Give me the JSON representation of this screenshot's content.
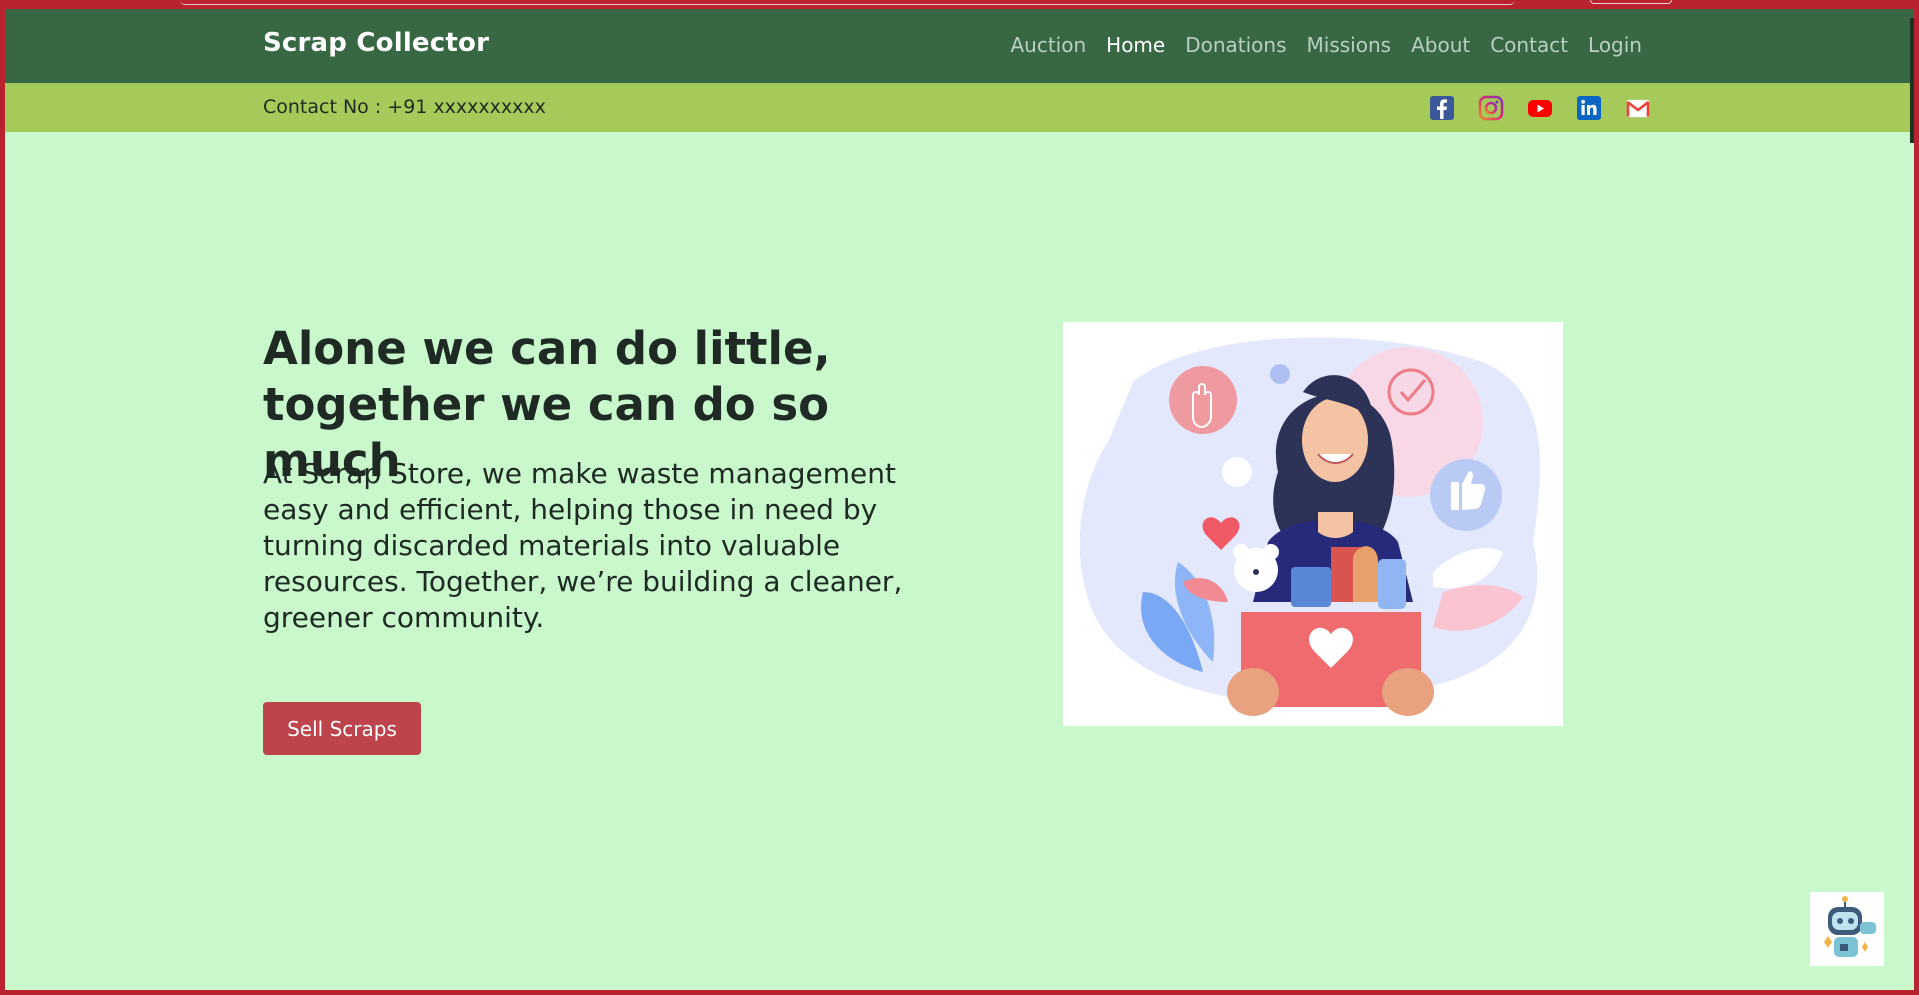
{
  "brand": "Scrap Collector",
  "nav": [
    "Auction",
    "Home",
    "Donations",
    "Missions",
    "About",
    "Contact",
    "Login"
  ],
  "nav_active": "Home",
  "contact": "Contact No : +91 xxxxxxxxxx",
  "socials": [
    "facebook-icon",
    "instagram-icon",
    "youtube-icon",
    "linkedin-icon",
    "gmail-icon"
  ],
  "hero": {
    "headline": "Alone we can do little, together we can do so much",
    "body": "At Scrap Store, we make waste management easy and efficient, helping those in need by turning discarded materials into valuable resources. Together, we’re building a cleaner, greener community.",
    "button": "Sell Scraps"
  },
  "colors": {
    "navbar": "#376843",
    "contactbar": "#a6ca5a",
    "page_bg": "#c8f8cb",
    "button": "#bd434c"
  }
}
